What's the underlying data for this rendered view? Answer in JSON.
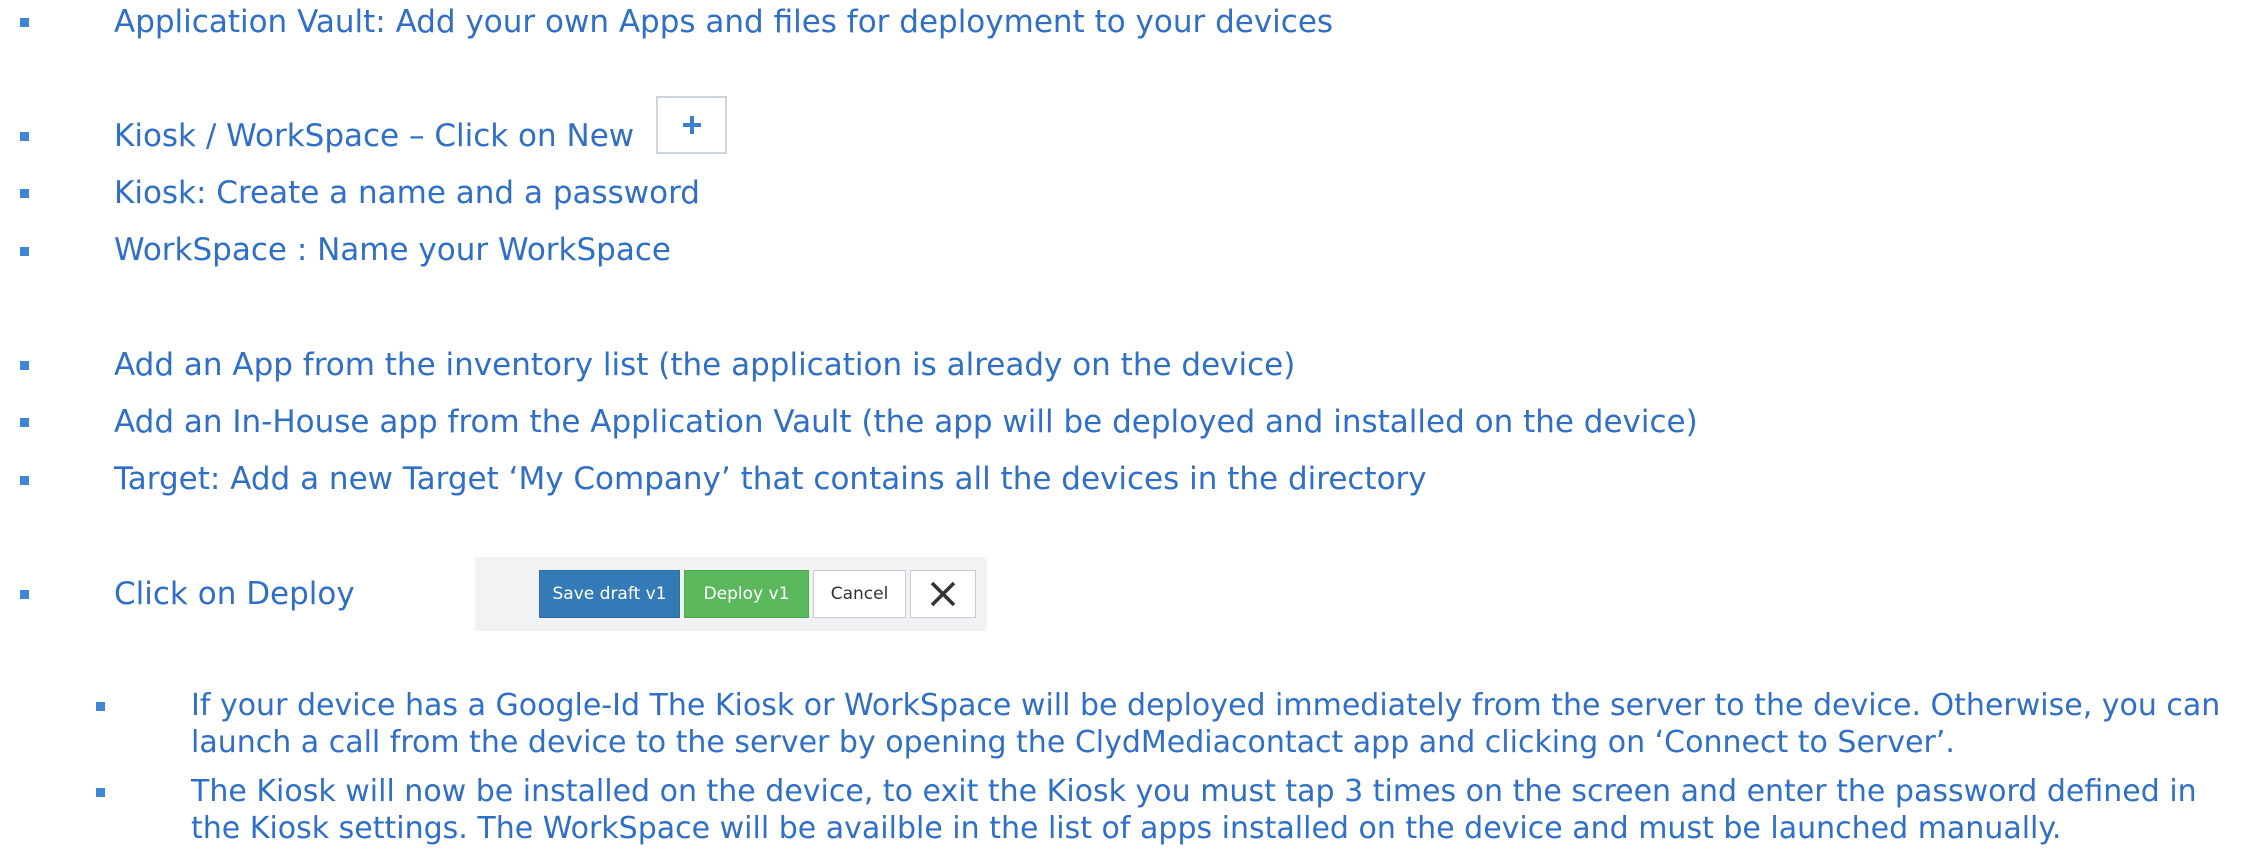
{
  "items": [
    "Application Vault: Add your own Apps and files for deployment to your devices",
    "Kiosk / WorkSpace – Click on New",
    "Kiosk: Create a name and a password",
    "WorkSpace : Name your WorkSpace",
    "Add an App from the inventory list (the application is already on the device)",
    "Add an In-House app from the Application Vault (the app will be deployed and installed on the device)",
    "Target: Add a new Target ‘My Company’ that contains all the devices in the directory",
    "Click on Deploy"
  ],
  "sub_items": [
    "If your device has a Google-Id The Kiosk or WorkSpace will be deployed immediately from the server to the device. Otherwise, you can launch a call from the device to the server by opening the ClydMediacontact app and clicking on ‘Connect to Server’.",
    "The Kiosk will now be installed on the device, to exit the Kiosk you must tap 3 times on the screen and enter the password defined in the Kiosk settings. The WorkSpace will be availble in the list of apps installed on the device and must be launched manually."
  ],
  "buttons": {
    "new_icon": "plus-icon",
    "save_draft": "Save draft v1",
    "deploy": "Deploy v1",
    "cancel": "Cancel",
    "close_icon": "close-icon"
  },
  "colors": {
    "text": "#2f6fc8",
    "bullet": "#3f86d6",
    "save_button": "#337ab7",
    "deploy_button": "#5cb85c"
  }
}
